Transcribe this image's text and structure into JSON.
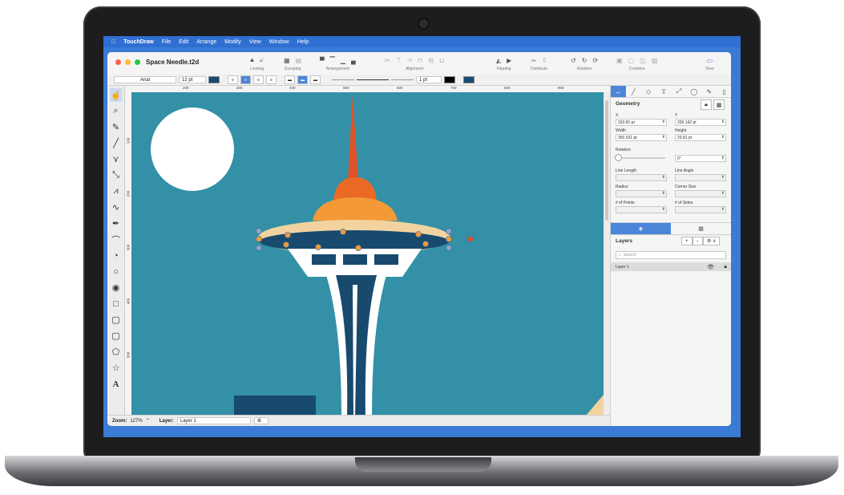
{
  "menubar": {
    "apple": "",
    "app_name": "TouchDraw",
    "items": [
      "File",
      "Edit",
      "Arrange",
      "Modify",
      "View",
      "Window",
      "Help"
    ]
  },
  "window": {
    "title": "Space Needle.t2d",
    "toolbar_groups": [
      {
        "label": "Locking",
        "icons": [
          "lock-icon",
          "unlock-icon"
        ]
      },
      {
        "label": "Grouping",
        "icons": [
          "group-icon",
          "ungroup-icon"
        ]
      },
      {
        "label": "Arrangement",
        "icons": [
          "front-icon",
          "forward-icon",
          "backward-icon",
          "back-icon"
        ]
      },
      {
        "label": "Alignment",
        "icons": [
          "align-left-icon",
          "align-center-icon",
          "align-right-icon",
          "align-top-icon",
          "align-middle-icon",
          "align-bottom-icon"
        ]
      },
      {
        "label": "Flipping",
        "icons": [
          "flip-horizontal-icon",
          "flip-vertical-icon"
        ]
      },
      {
        "label": "Distribute",
        "icons": [
          "distribute-horizontal-icon",
          "distribute-vertical-icon"
        ]
      },
      {
        "label": "Rotation",
        "icons": [
          "rotate-left-icon",
          "rotate-right-icon",
          "rotate-free-icon"
        ]
      },
      {
        "label": "Combine",
        "icons": [
          "union-icon",
          "subtract-icon",
          "intersect-icon",
          "exclude-icon"
        ]
      },
      {
        "label": "View",
        "icons": [
          "view-sidebar-icon"
        ]
      }
    ],
    "format": {
      "font_name": "Arial",
      "font_size": "12 pt",
      "font_color": "#1a4a6e",
      "line_width": "1 pt",
      "stroke_color": "#000000",
      "fill_color": "#1a4a6e"
    },
    "rulers": {
      "top": [
        "200",
        "300",
        "400",
        "500",
        "600",
        "700",
        "800",
        "900"
      ],
      "left": [
        "100",
        "200",
        "300",
        "400",
        "500"
      ]
    },
    "status": {
      "zoom_label": "Zoom:",
      "zoom_value": "127%",
      "layer_label": "Layer:",
      "layer_value": "Layer 1"
    }
  },
  "inspector": {
    "tabs": [
      "arrange-tab-icon",
      "line-tab-icon",
      "fill-tab-icon",
      "text-tab-icon",
      "shadow-tab-icon",
      "effects-tab-icon",
      "style-tab-icon",
      "document-tab-icon"
    ],
    "title": "Geometry",
    "x_label": "X",
    "x_value": "333.81 pt",
    "y_label": "Y",
    "y_value": "259.142 pt",
    "width_label": "Width",
    "width_value": "350.531 pt",
    "height_label": "Height",
    "height_value": "29.81 pt",
    "rotation_label": "Rotation",
    "rotation_value": "0°",
    "line_length_label": "Line Length",
    "line_angle_label": "Line Angle",
    "radius_label": "Radius",
    "corner_size_label": "Corner Size",
    "points_label": "# of Points",
    "sides_label": "# of Sides"
  },
  "layers_panel": {
    "title": "Layers",
    "add_label": "+",
    "remove_label": "−",
    "options_label": "⚙ ∨",
    "search_placeholder": "Search",
    "layers": [
      {
        "name": "Layer 1",
        "visible": true,
        "locked": true
      }
    ]
  },
  "colors": {
    "canvas": "#3390a6",
    "sun": "#ffffff",
    "spire": "#e0532a",
    "dome_top": "#ea6a24",
    "dome_mid": "#f39a36",
    "halo": "#f2d3a0",
    "deck": "#184a6e",
    "menubar": "#2f6fd1",
    "accent": "#4b86d9"
  }
}
